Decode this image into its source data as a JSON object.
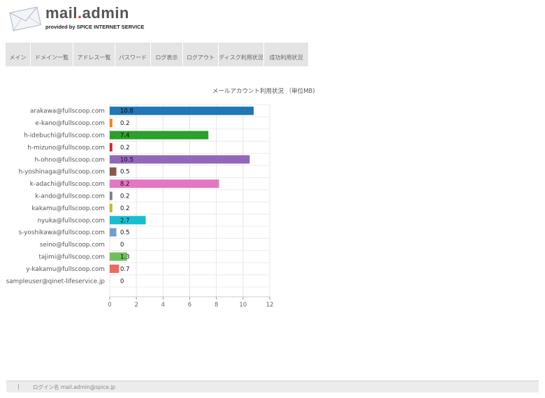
{
  "header": {
    "logo_main": "mail",
    "logo_dot": ".",
    "logo_suffix": "admin",
    "logo_sub": "provided by SPICE INTERNET SERVICE"
  },
  "nav": {
    "tabs": [
      {
        "label": "メイン"
      },
      {
        "label": "ドメイン一覧"
      },
      {
        "label": "アドレス一覧"
      },
      {
        "label": "パスワード"
      },
      {
        "label": "ログ表示"
      },
      {
        "label": "ログアウト"
      },
      {
        "label": "ディスク利用状況"
      },
      {
        "label": "成功利用状況"
      }
    ]
  },
  "footer": {
    "separator": "|",
    "text": "ログイン名 mail.admin@spice.jp"
  },
  "colors": {
    "palette": [
      "#1f77b4",
      "#ff7f0e",
      "#2ca02c",
      "#d62728",
      "#9467bd",
      "#8c564b",
      "#e377c2",
      "#7f7f7f",
      "#bcbd22",
      "#17becf",
      "#6fa0cc",
      "#ffffff",
      "#6fbf5c",
      "#ec6a5e",
      "#ffffff"
    ]
  },
  "chart_data": {
    "type": "bar",
    "orientation": "horizontal",
    "title": "メールアカウント利用状況 （単位MB)",
    "categories": [
      "arakawa@fullscoop.com",
      "e-kano@fullscoop.com",
      "h-idebuchi@fullscoop.com",
      "h-mizuno@fullscoop.com",
      "h-ohno@fullscoop.com",
      "h-yoshinaga@fullscoop.com",
      "k-adachi@fullscoop.com",
      "k-ando@fullscoop.com",
      "kakamu@fullscoop.com",
      "nyuka@fullscoop.com",
      "s-yoshikawa@fullscoop.com",
      "seino@fullscoop.com",
      "tajimi@fullscoop.com",
      "y-kakamu@fullscoop.com",
      "sampleuser@qinet-lifeservice.jp"
    ],
    "values": [
      10.8,
      0.2,
      7.4,
      0.2,
      10.5,
      0.5,
      8.2,
      0.2,
      0.2,
      2.7,
      0.5,
      0,
      1.3,
      0.7,
      0
    ],
    "value_labels": [
      "10.8",
      "0.2",
      "7.4",
      "0.2",
      "10.5",
      "0.5",
      "8.2",
      "0.2",
      "0.2",
      "2.7",
      "0.5",
      "0",
      "1.3",
      "0.7",
      "0"
    ],
    "xlim": [
      0,
      12
    ],
    "xticks": [
      0,
      2,
      4,
      6,
      8,
      10,
      12
    ],
    "grid": true
  }
}
